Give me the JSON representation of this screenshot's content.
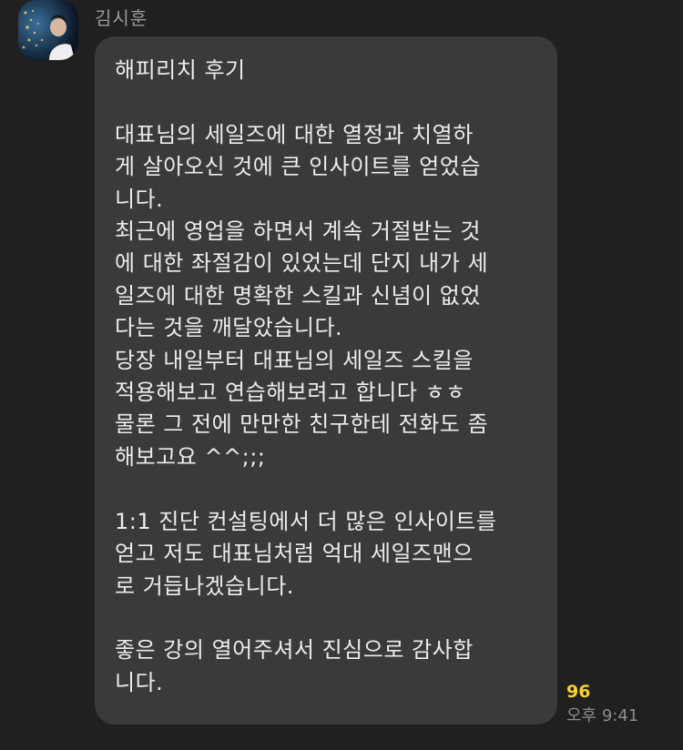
{
  "chat": {
    "sender": {
      "name": "김시훈",
      "avatar_icon": "profile-photo"
    },
    "message": {
      "text": "해피리치 후기\n\n대표님의 세일즈에 대한 열정과 치열하\n게 살아오신 것에 큰 인사이트를 얻었습\n니다.\n최근에 영업을 하면서 계속 거절받는 것\n에 대한 좌절감이 있었는데 단지 내가 세\n일즈에 대한 명확한 스킬과 신념이 없었\n다는 것을 깨달았습니다.\n당장 내일부터 대표님의 세일즈 스킬을\n적용해보고 연습해보려고 합니다 ㅎㅎ\n물론 그 전에 만만한 친구한테 전화도 좀\n해보고요 ^^;;;\n\n1:1 진단 컨설팅에서 더 많은 인사이트를\n얻고 저도 대표님처럼 억대 세일즈맨으\n로 거듭나겠습니다.\n\n좋은 강의 열어주셔서 진심으로 감사합\n니다.",
      "unread_count": "96",
      "timestamp": "오후 9:41"
    }
  },
  "colors": {
    "background": "#202021",
    "bubble": "#3a3a3b",
    "text": "#ececec",
    "unread": "#f5d22f",
    "meta": "#8d8d8d"
  }
}
